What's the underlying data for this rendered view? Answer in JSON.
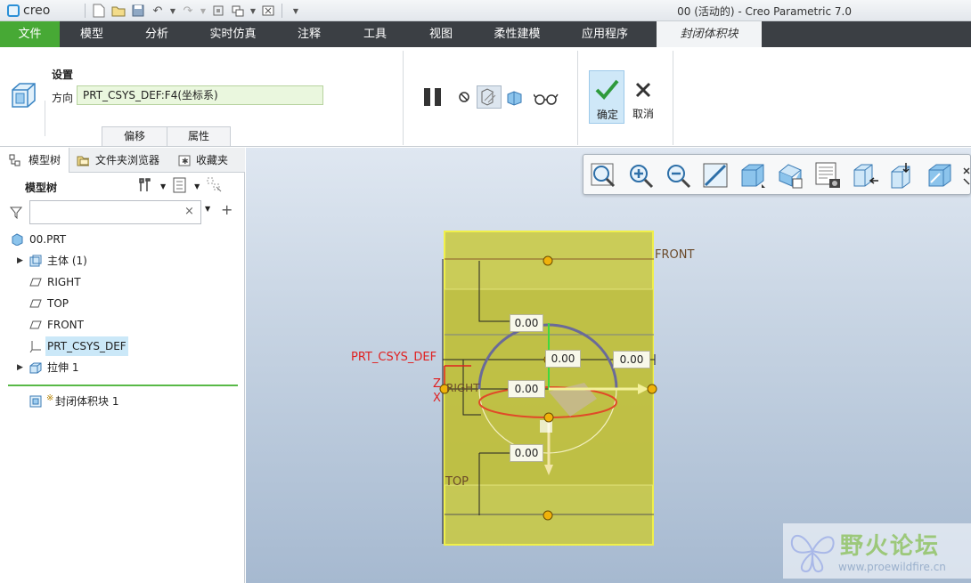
{
  "app": {
    "logo_text": "creo",
    "window_title": "00 (活动的) - Creo Parametric 7.0"
  },
  "menu": {
    "items": [
      "文件",
      "模型",
      "分析",
      "实时仿真",
      "注释",
      "工具",
      "视图",
      "柔性建模",
      "应用程序",
      "封闭体积块"
    ]
  },
  "ribbon": {
    "setup_label": "设置",
    "direction_label": "方向",
    "direction_value": "PRT_CSYS_DEF:F4(坐标系)",
    "tab_offset": "偏移",
    "tab_properties": "属性",
    "ok_label": "确定",
    "cancel_label": "取消"
  },
  "panel": {
    "tabs": [
      "模型树",
      "文件夹浏览器",
      "收藏夹"
    ],
    "tree_title": "模型树",
    "items": [
      {
        "label": "00.PRT",
        "icon": "part-icon"
      },
      {
        "label": "主体 (1)",
        "icon": "body-icon",
        "expandable": true
      },
      {
        "label": "RIGHT",
        "icon": "datum-plane-icon"
      },
      {
        "label": "TOP",
        "icon": "datum-plane-icon"
      },
      {
        "label": "FRONT",
        "icon": "datum-plane-icon"
      },
      {
        "label": "PRT_CSYS_DEF",
        "icon": "coordinate-system-icon",
        "selected": true
      },
      {
        "label": "拉伸 1",
        "icon": "extrude-icon",
        "expandable": true
      }
    ],
    "insert_item": "封闭体积块 1",
    "insert_marker": "※"
  },
  "viewport": {
    "plane_labels": {
      "front": "FRONT",
      "top": "TOP",
      "right": "RIGHT",
      "csys": "PRT_CSYS_DEF",
      "axis_z": "Z",
      "axis_x": "X"
    },
    "dimensions": [
      "0.00",
      "0.00",
      "0.00",
      "0.00",
      "0.00"
    ]
  },
  "watermark": {
    "text": "野火论坛",
    "url": "www.proewildfire.cn"
  },
  "colors": {
    "menu_bar": "#3b3f44",
    "file_tab": "#47a935",
    "model_fill": "#c9c93e",
    "selection": "#cbe8f8"
  }
}
